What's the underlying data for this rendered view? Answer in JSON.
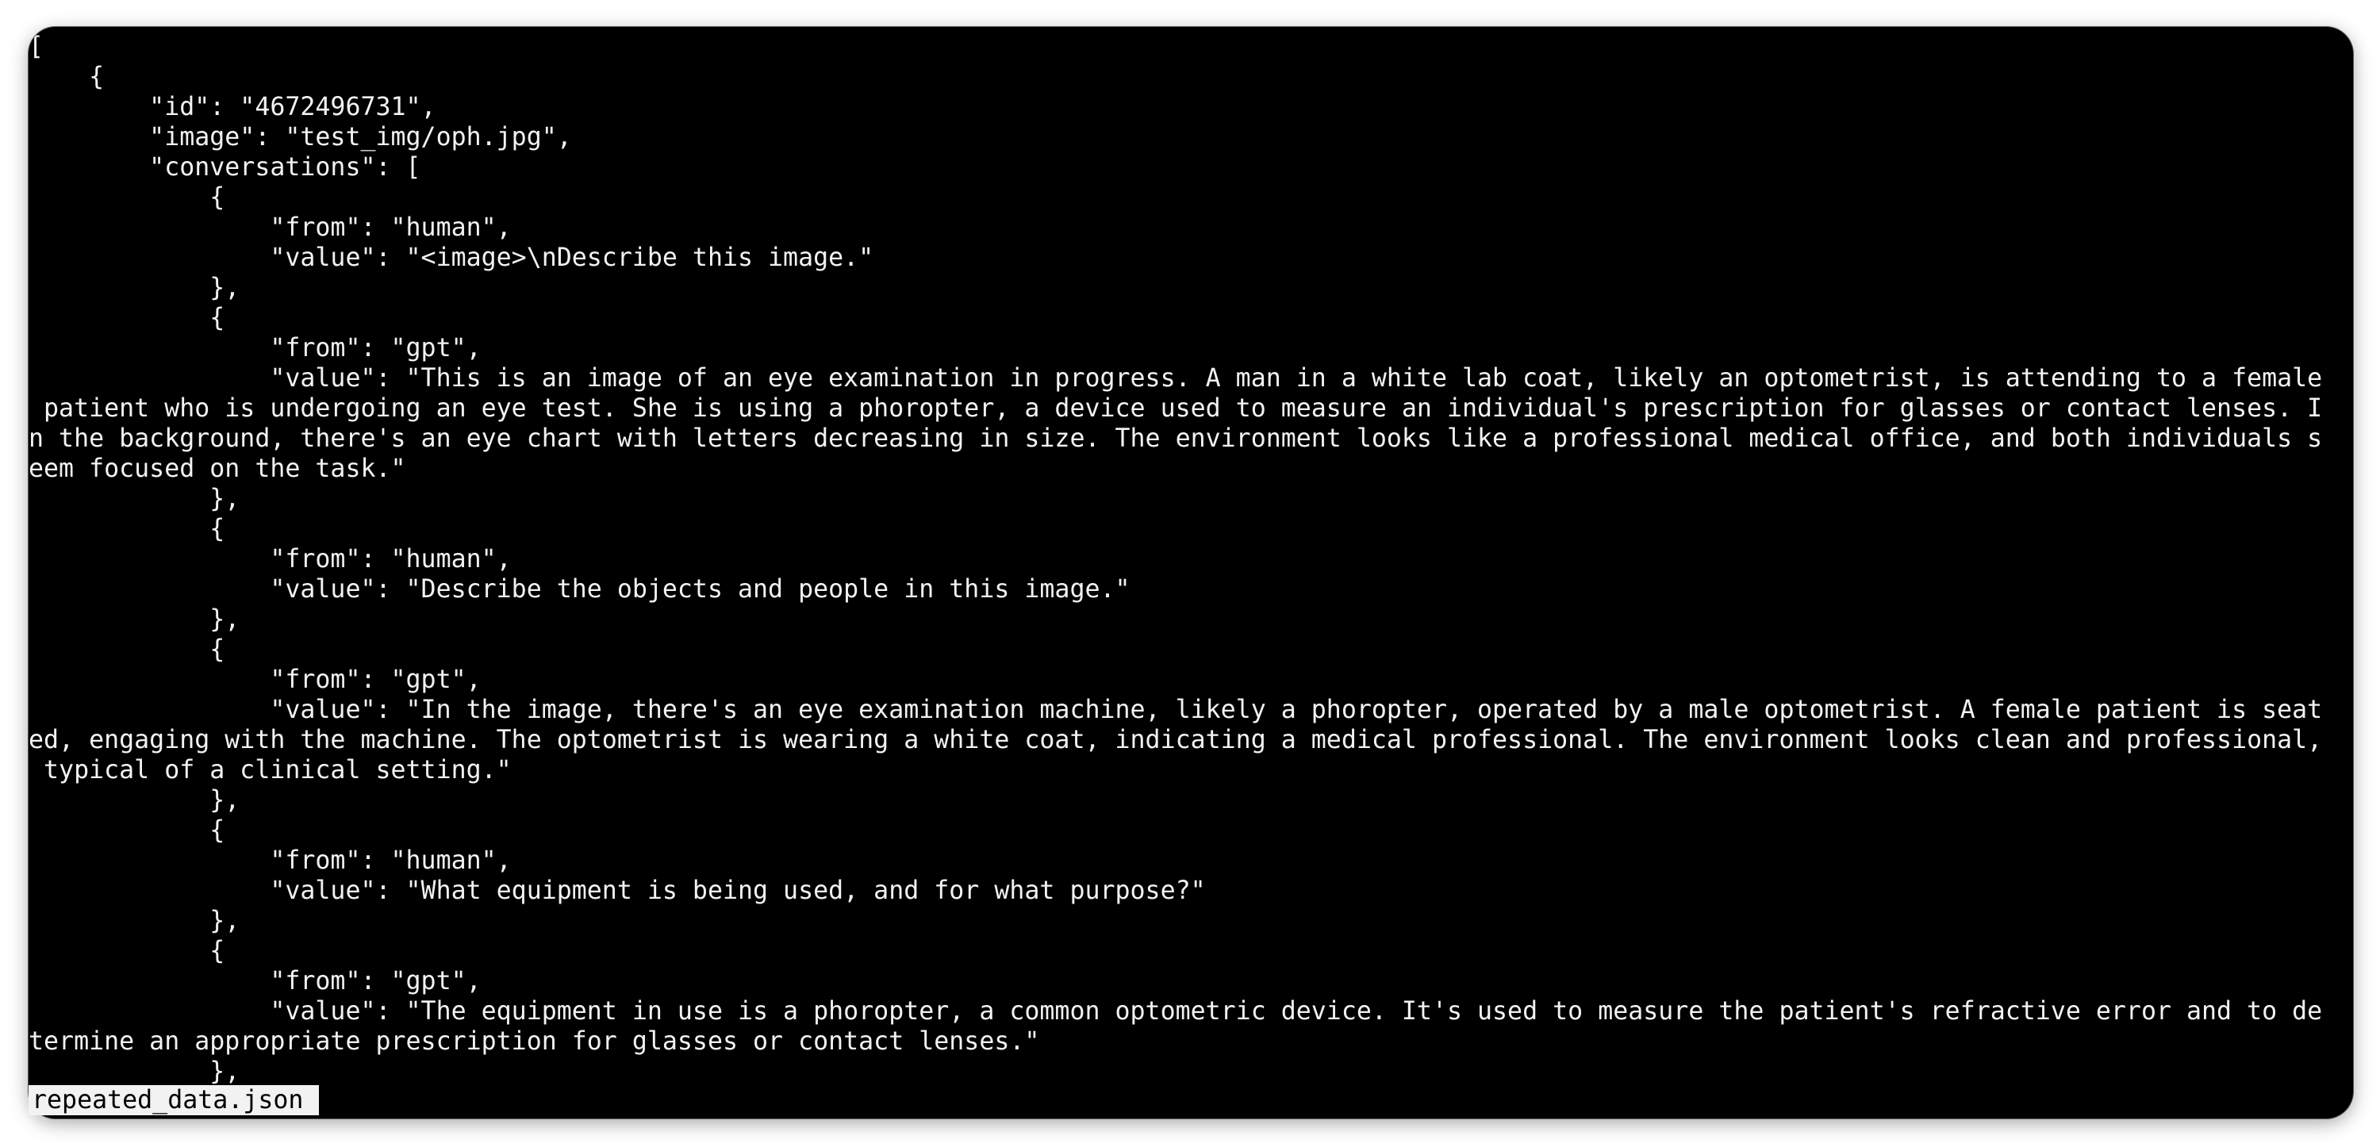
{
  "terminal": {
    "lines": [
      "[",
      "    {",
      "        \"id\": \"4672496731\",",
      "        \"image\": \"test_img/oph.jpg\",",
      "        \"conversations\": [",
      "            {",
      "                \"from\": \"human\",",
      "                \"value\": \"<image>\\nDescribe this image.\"",
      "            },",
      "            {",
      "                \"from\": \"gpt\",",
      "                \"value\": \"This is an image of an eye examination in progress. A man in a white lab coat, likely an optometrist, is attending to a female",
      " patient who is undergoing an eye test. She is using a phoropter, a device used to measure an individual's prescription for glasses or contact lenses. I",
      "n the background, there's an eye chart with letters decreasing in size. The environment looks like a professional medical office, and both individuals s",
      "eem focused on the task.\"",
      "            },",
      "            {",
      "                \"from\": \"human\",",
      "                \"value\": \"Describe the objects and people in this image.\"",
      "            },",
      "            {",
      "                \"from\": \"gpt\",",
      "                \"value\": \"In the image, there's an eye examination machine, likely a phoropter, operated by a male optometrist. A female patient is seat",
      "ed, engaging with the machine. The optometrist is wearing a white coat, indicating a medical professional. The environment looks clean and professional,",
      " typical of a clinical setting.\"",
      "            },",
      "            {",
      "                \"from\": \"human\",",
      "                \"value\": \"What equipment is being used, and for what purpose?\"",
      "            },",
      "            {",
      "                \"from\": \"gpt\",",
      "                \"value\": \"The equipment in use is a phoropter, a common optometric device. It's used to measure the patient's refractive error and to de",
      "termine an appropriate prescription for glasses or contact lenses.\"",
      "            },"
    ],
    "status_filename": "repeated_data.json"
  },
  "colors": {
    "background": "#000000",
    "foreground": "#f2f2f2",
    "status_bg": "#f2f2f2",
    "status_fg": "#000000"
  }
}
